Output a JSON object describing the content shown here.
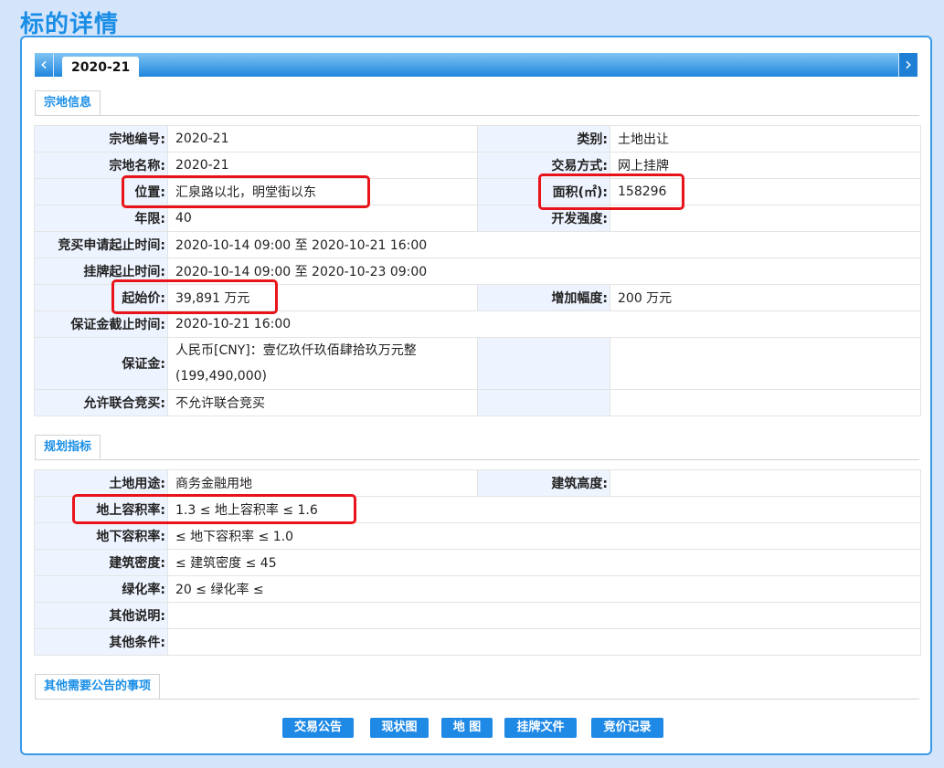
{
  "page_title": "标的详情",
  "tab": {
    "label": "2020-21",
    "prev_icon": "chevron-left-icon",
    "next_icon": "chevron-right-icon"
  },
  "section_land": {
    "title": "宗地信息",
    "rows": [
      {
        "l1": "宗地编号:",
        "v1": "2020-21",
        "l2": "类别:",
        "v2": "土地出让"
      },
      {
        "l1": "宗地名称:",
        "v1": "2020-21",
        "l2": "交易方式:",
        "v2": "网上挂牌"
      },
      {
        "l1": "位置:",
        "v1": "汇泉路以北，明堂街以东",
        "l2": "面积(㎡):",
        "v2": "158296"
      },
      {
        "l1": "年限:",
        "v1": "40",
        "l2": "开发强度:",
        "v2": ""
      },
      {
        "l1": "竞买申请起止时间:",
        "v1": "2020-10-14 09:00 至 2020-10-21 16:00"
      },
      {
        "l1": "挂牌起止时间:",
        "v1": "2020-10-14 09:00 至 2020-10-23 09:00"
      },
      {
        "l1": "起始价:",
        "v1": "39,891 万元",
        "l2": "增加幅度:",
        "v2": "200 万元"
      },
      {
        "l1": "保证金截止时间:",
        "v1": "2020-10-21 16:00"
      },
      {
        "l1": "保证金:",
        "v1a": "人民币[CNY]：壹亿玖仟玖佰肆拾玖万元整",
        "v1b": "(199,490,000)"
      },
      {
        "l1": "允许联合竞买:",
        "v1": "不允许联合竞买"
      }
    ]
  },
  "section_plan": {
    "title": "规划指标",
    "rows": [
      {
        "l1": "土地用途:",
        "v1": "商务金融用地",
        "l2": "建筑高度:",
        "v2": ""
      },
      {
        "l1": "地上容积率:",
        "v1": "1.3 ≤ 地上容积率 ≤ 1.6"
      },
      {
        "l1": "地下容积率:",
        "v1": "≤ 地下容积率 ≤ 1.0"
      },
      {
        "l1": "建筑密度:",
        "v1": "≤ 建筑密度 ≤ 45"
      },
      {
        "l1": "绿化率:",
        "v1": "20 ≤ 绿化率 ≤"
      },
      {
        "l1": "其他说明:",
        "v1": ""
      },
      {
        "l1": "其他条件:",
        "v1": ""
      }
    ]
  },
  "section_other": {
    "title": "其他需要公告的事项"
  },
  "buttons": {
    "announcement": "交易公告",
    "status_map": "现状图",
    "map": "地 图",
    "listing_docs": "挂牌文件",
    "bid_record": "竞价记录"
  },
  "colors": {
    "accent": "#1a8ee6",
    "highlight": "#e8141a",
    "label_bg": "#eef4ff"
  }
}
